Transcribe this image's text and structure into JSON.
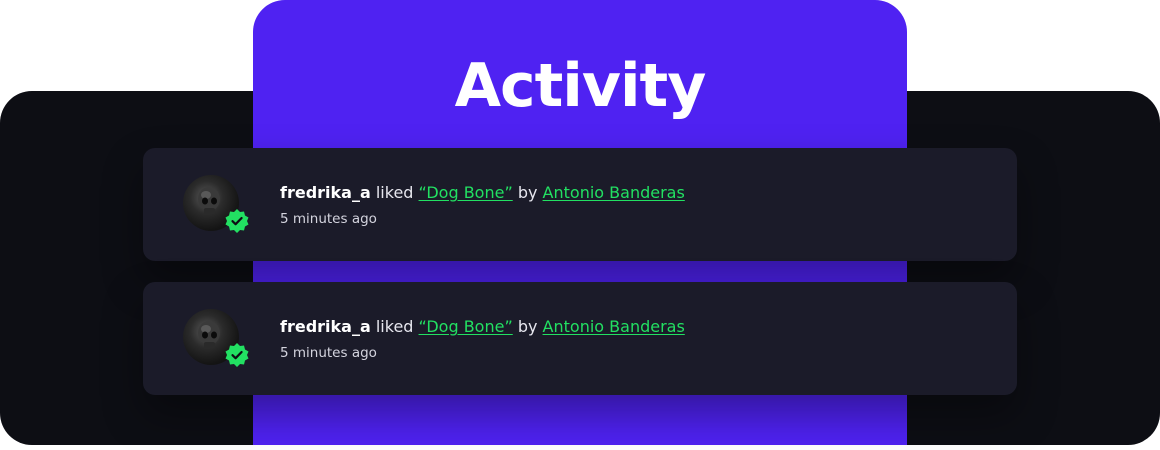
{
  "panel": {
    "title": "Activity"
  },
  "colors": {
    "accent_purple": "#4f22f2",
    "link_green": "#22e062",
    "card_bg": "#1b1b29",
    "dark_bg": "#0d0e14"
  },
  "activities": [
    {
      "username": "fredrika_a",
      "action": "liked",
      "track": "“Dog Bone”",
      "by": "by",
      "artist": "Antonio Banderas",
      "time": "5 minutes ago",
      "avatar_icon": "skull-avatar",
      "badge_icon": "verified-badge-icon"
    },
    {
      "username": "fredrika_a",
      "action": "liked",
      "track": "“Dog Bone”",
      "by": "by",
      "artist": "Antonio Banderas",
      "time": "5 minutes ago",
      "avatar_icon": "skull-avatar",
      "badge_icon": "verified-badge-icon"
    }
  ]
}
